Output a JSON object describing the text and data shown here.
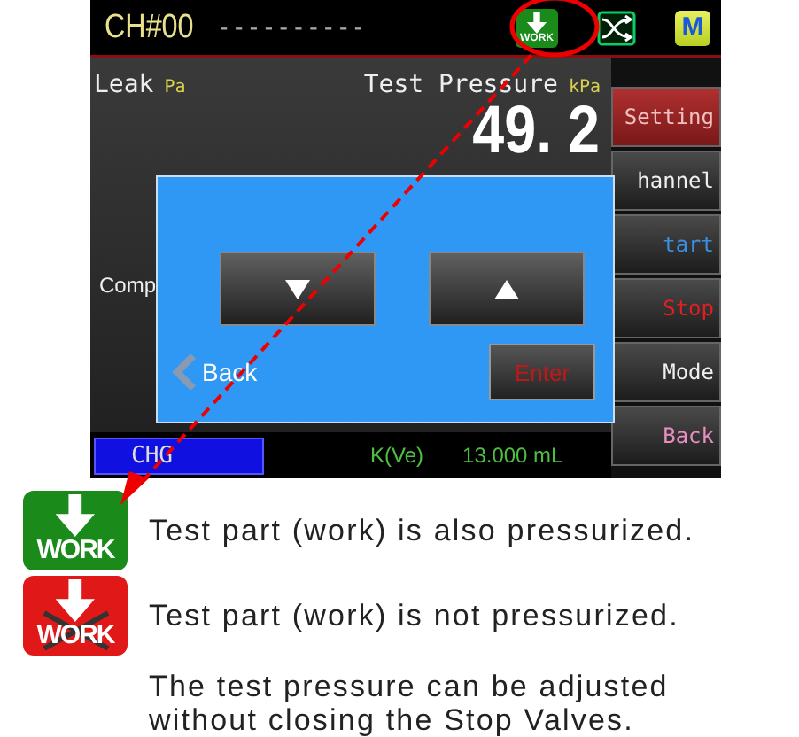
{
  "header": {
    "channel": "CH#00",
    "name": "----------",
    "work_icon_label": "WORK",
    "mode_icon_label": "M"
  },
  "readings": {
    "leak_label": "Leak",
    "leak_unit": "Pa",
    "pressure_label": "Test Pressure",
    "pressure_unit": "kPa",
    "pressure_value": "49. 2",
    "comp_label": "Comp"
  },
  "status": {
    "state": "CHG",
    "k_label": "K(Ve)",
    "volume": "13.000 mL"
  },
  "side_buttons": [
    {
      "label": "Setting",
      "kind": "setting"
    },
    {
      "label": "hannel",
      "kind": "plain"
    },
    {
      "label": "tart",
      "kind": "start"
    },
    {
      "label": "Stop",
      "kind": "stop"
    },
    {
      "label": "Mode",
      "kind": "plain"
    },
    {
      "label": "Back",
      "kind": "back"
    }
  ],
  "dialog": {
    "back_label": "Back",
    "enter_label": "Enter"
  },
  "legend": [
    {
      "kind": "pressurized",
      "icon_label": "WORK",
      "text": "Test part (work) is also pressurized."
    },
    {
      "kind": "not_pressurized",
      "icon_label": "WORK",
      "text": "Test part (work) is not pressurized."
    }
  ],
  "note": "The test pressure can be adjusted without closing the Stop Valves."
}
